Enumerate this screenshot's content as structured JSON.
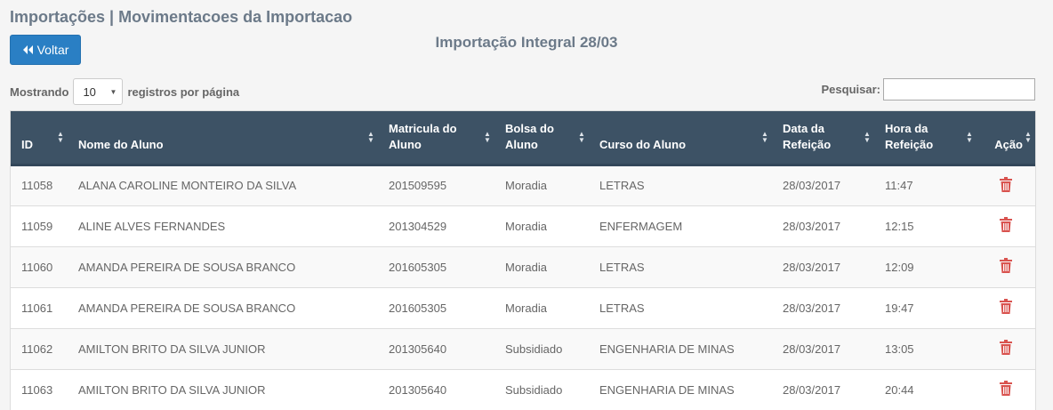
{
  "header": {
    "title": "Importações | Movimentacoes da Importacao",
    "back_label": "Voltar",
    "import_title": "Importação Integral 28/03"
  },
  "length_control": {
    "prefix": "Mostrando",
    "selected": "10",
    "suffix": "registros por página"
  },
  "search": {
    "label": "Pesquisar:",
    "value": ""
  },
  "colors": {
    "header_bg": "#3d5265",
    "button": "#2a7fc4",
    "trash": "#d9534f"
  },
  "table": {
    "columns": [
      {
        "line1": "ID",
        "line2": ""
      },
      {
        "line1": "Nome do Aluno",
        "line2": ""
      },
      {
        "line1": "Matricula do",
        "line2": "Aluno"
      },
      {
        "line1": "Bolsa do",
        "line2": "Aluno"
      },
      {
        "line1": "Curso do Aluno",
        "line2": ""
      },
      {
        "line1": "Data da",
        "line2": "Refeição"
      },
      {
        "line1": "Hora da",
        "line2": "Refeição"
      },
      {
        "line1": "Ação",
        "line2": ""
      }
    ],
    "rows": [
      {
        "id": "11058",
        "nome": "ALANA CAROLINE MONTEIRO DA SILVA",
        "matricula": "201509595",
        "bolsa": "Moradia",
        "curso": "LETRAS",
        "data": "28/03/2017",
        "hora": "11:47",
        "action_icon": "trash-icon"
      },
      {
        "id": "11059",
        "nome": "ALINE ALVES FERNANDES",
        "matricula": "201304529",
        "bolsa": "Moradia",
        "curso": "ENFERMAGEM",
        "data": "28/03/2017",
        "hora": "12:15",
        "action_icon": "trash-icon"
      },
      {
        "id": "11060",
        "nome": "AMANDA PEREIRA DE SOUSA BRANCO",
        "matricula": "201605305",
        "bolsa": "Moradia",
        "curso": "LETRAS",
        "data": "28/03/2017",
        "hora": "12:09",
        "action_icon": "trash-icon"
      },
      {
        "id": "11061",
        "nome": "AMANDA PEREIRA DE SOUSA BRANCO",
        "matricula": "201605305",
        "bolsa": "Moradia",
        "curso": "LETRAS",
        "data": "28/03/2017",
        "hora": "19:47",
        "action_icon": "trash-icon"
      },
      {
        "id": "11062",
        "nome": "AMILTON BRITO DA SILVA JUNIOR",
        "matricula": "201305640",
        "bolsa": "Subsidiado",
        "curso": "ENGENHARIA DE MINAS",
        "data": "28/03/2017",
        "hora": "13:05",
        "action_icon": "trash-icon"
      },
      {
        "id": "11063",
        "nome": "AMILTON BRITO DA SILVA JUNIOR",
        "matricula": "201305640",
        "bolsa": "Subsidiado",
        "curso": "ENGENHARIA DE MINAS",
        "data": "28/03/2017",
        "hora": "20:44",
        "action_icon": "trash-icon"
      }
    ]
  }
}
